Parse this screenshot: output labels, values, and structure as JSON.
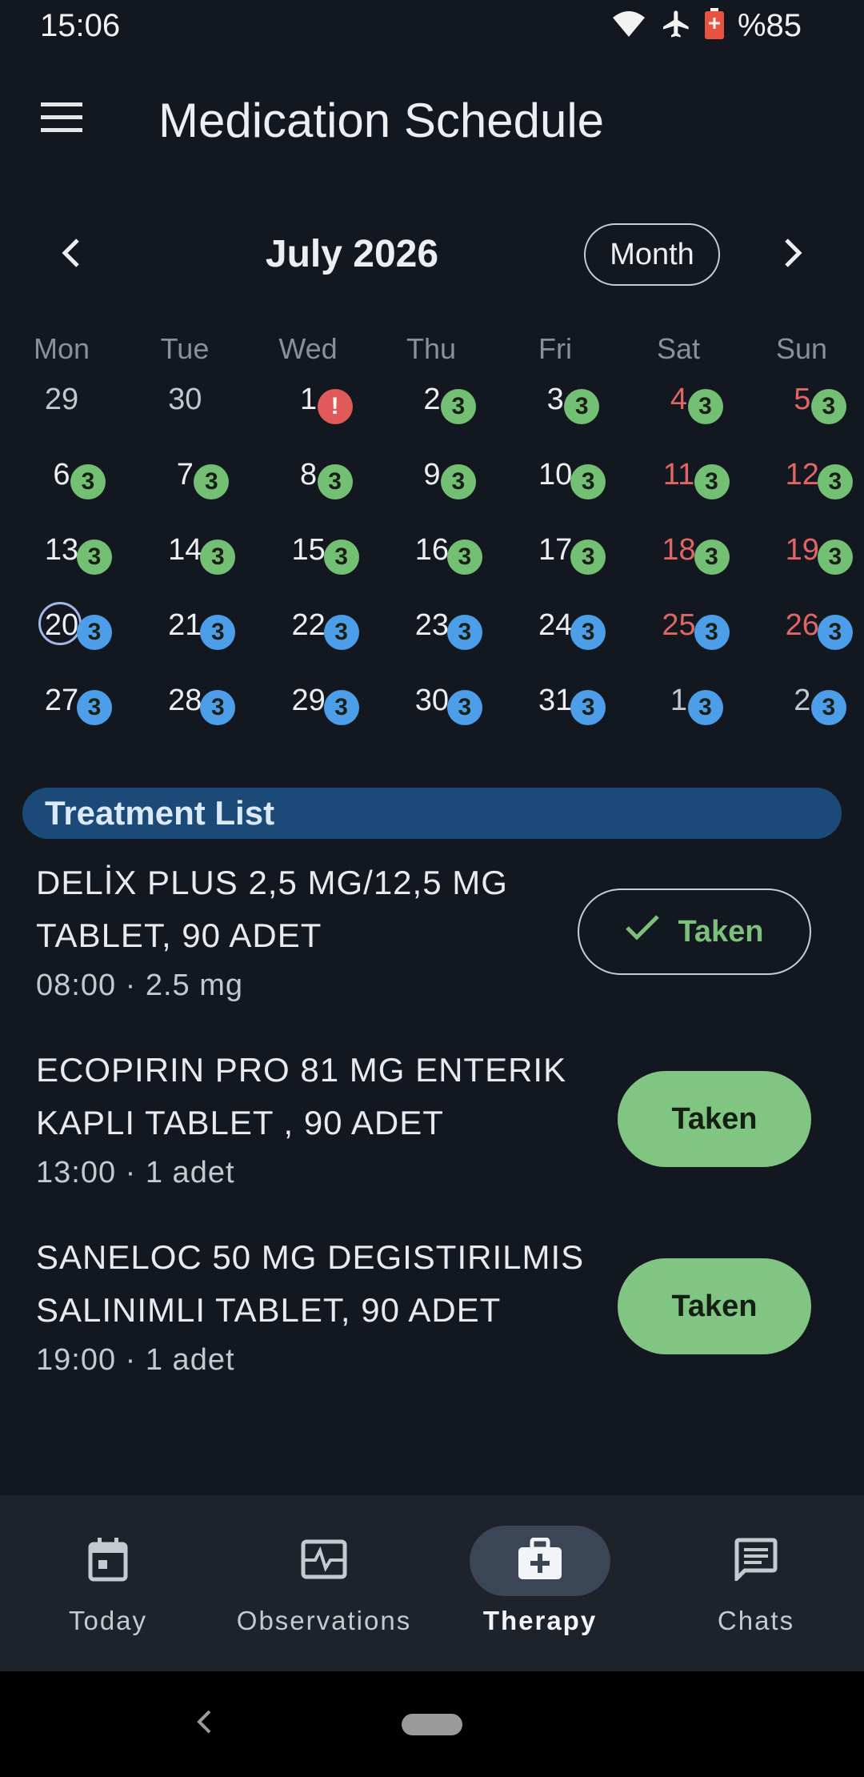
{
  "status_bar": {
    "time": "15:06",
    "battery": "%85"
  },
  "app_bar": {
    "title": "Medication Schedule",
    "menu_icon": "menu-icon"
  },
  "calendar": {
    "month_label": "July 2026",
    "view_mode": "Month",
    "weekdays": [
      "Mon",
      "Tue",
      "Wed",
      "Thu",
      "Fri",
      "Sat",
      "Sun"
    ],
    "weeks": [
      [
        {
          "day": "29",
          "badge": "",
          "kind": "",
          "other": true
        },
        {
          "day": "30",
          "badge": "",
          "kind": "",
          "other": true
        },
        {
          "day": "1",
          "badge": "!",
          "kind": "alert"
        },
        {
          "day": "2",
          "badge": "3",
          "kind": "done"
        },
        {
          "day": "3",
          "badge": "3",
          "kind": "done"
        },
        {
          "day": "4",
          "badge": "3",
          "kind": "done",
          "weekend": true
        },
        {
          "day": "5",
          "badge": "3",
          "kind": "done",
          "weekend": true
        }
      ],
      [
        {
          "day": "6",
          "badge": "3",
          "kind": "done"
        },
        {
          "day": "7",
          "badge": "3",
          "kind": "done"
        },
        {
          "day": "8",
          "badge": "3",
          "kind": "done"
        },
        {
          "day": "9",
          "badge": "3",
          "kind": "done"
        },
        {
          "day": "10",
          "badge": "3",
          "kind": "done"
        },
        {
          "day": "11",
          "badge": "3",
          "kind": "done",
          "weekend": true
        },
        {
          "day": "12",
          "badge": "3",
          "kind": "done",
          "weekend": true
        }
      ],
      [
        {
          "day": "13",
          "badge": "3",
          "kind": "done"
        },
        {
          "day": "14",
          "badge": "3",
          "kind": "done"
        },
        {
          "day": "15",
          "badge": "3",
          "kind": "done"
        },
        {
          "day": "16",
          "badge": "3",
          "kind": "done"
        },
        {
          "day": "17",
          "badge": "3",
          "kind": "done"
        },
        {
          "day": "18",
          "badge": "3",
          "kind": "done",
          "weekend": true
        },
        {
          "day": "19",
          "badge": "3",
          "kind": "done",
          "weekend": true
        }
      ],
      [
        {
          "day": "20",
          "badge": "3",
          "kind": "planned",
          "today": true
        },
        {
          "day": "21",
          "badge": "3",
          "kind": "planned"
        },
        {
          "day": "22",
          "badge": "3",
          "kind": "planned"
        },
        {
          "day": "23",
          "badge": "3",
          "kind": "planned"
        },
        {
          "day": "24",
          "badge": "3",
          "kind": "planned"
        },
        {
          "day": "25",
          "badge": "3",
          "kind": "planned",
          "weekend": true
        },
        {
          "day": "26",
          "badge": "3",
          "kind": "planned",
          "weekend": true
        }
      ],
      [
        {
          "day": "27",
          "badge": "3",
          "kind": "planned"
        },
        {
          "day": "28",
          "badge": "3",
          "kind": "planned"
        },
        {
          "day": "29",
          "badge": "3",
          "kind": "planned"
        },
        {
          "day": "30",
          "badge": "3",
          "kind": "planned"
        },
        {
          "day": "31",
          "badge": "3",
          "kind": "planned"
        },
        {
          "day": "1",
          "badge": "3",
          "kind": "planned",
          "other": true
        },
        {
          "day": "2",
          "badge": "3",
          "kind": "planned",
          "other": true
        }
      ]
    ]
  },
  "treatment": {
    "title": "Treatment List",
    "items": [
      {
        "name_line1": "DELİX PLUS 2,5 MG/12,5 MG",
        "name_line2": "TABLET, 90 ADET",
        "dose": "08:00 · 2.5 mg",
        "action": "Taken"
      },
      {
        "name_line1": "ECOPIRIN PRO 81 MG  ENTERIK",
        "name_line2": "KAPLI TABLET , 90 ADET",
        "dose": "13:00 · 1 adet",
        "action": "Taken"
      },
      {
        "name_line1": "SANELOC 50 MG DEGISTIRILMIS",
        "name_line2": "SALINIMLI TABLET, 90 ADET",
        "dose": "19:00 · 1 adet",
        "action": "Taken"
      }
    ]
  },
  "bottom_nav": {
    "items": [
      {
        "label": "Today",
        "icon": "calendar-icon"
      },
      {
        "label": "Observations",
        "icon": "vitals-icon"
      },
      {
        "label": "Therapy",
        "icon": "medical-kit-icon",
        "active": true
      },
      {
        "label": "Chats",
        "icon": "chat-icon"
      }
    ]
  },
  "colors": {
    "background": "#131720",
    "taken_green": "#80c581",
    "planned_blue": "#4d9ee8",
    "weekend_red": "#e06565",
    "header_blue": "#1c4a78"
  }
}
